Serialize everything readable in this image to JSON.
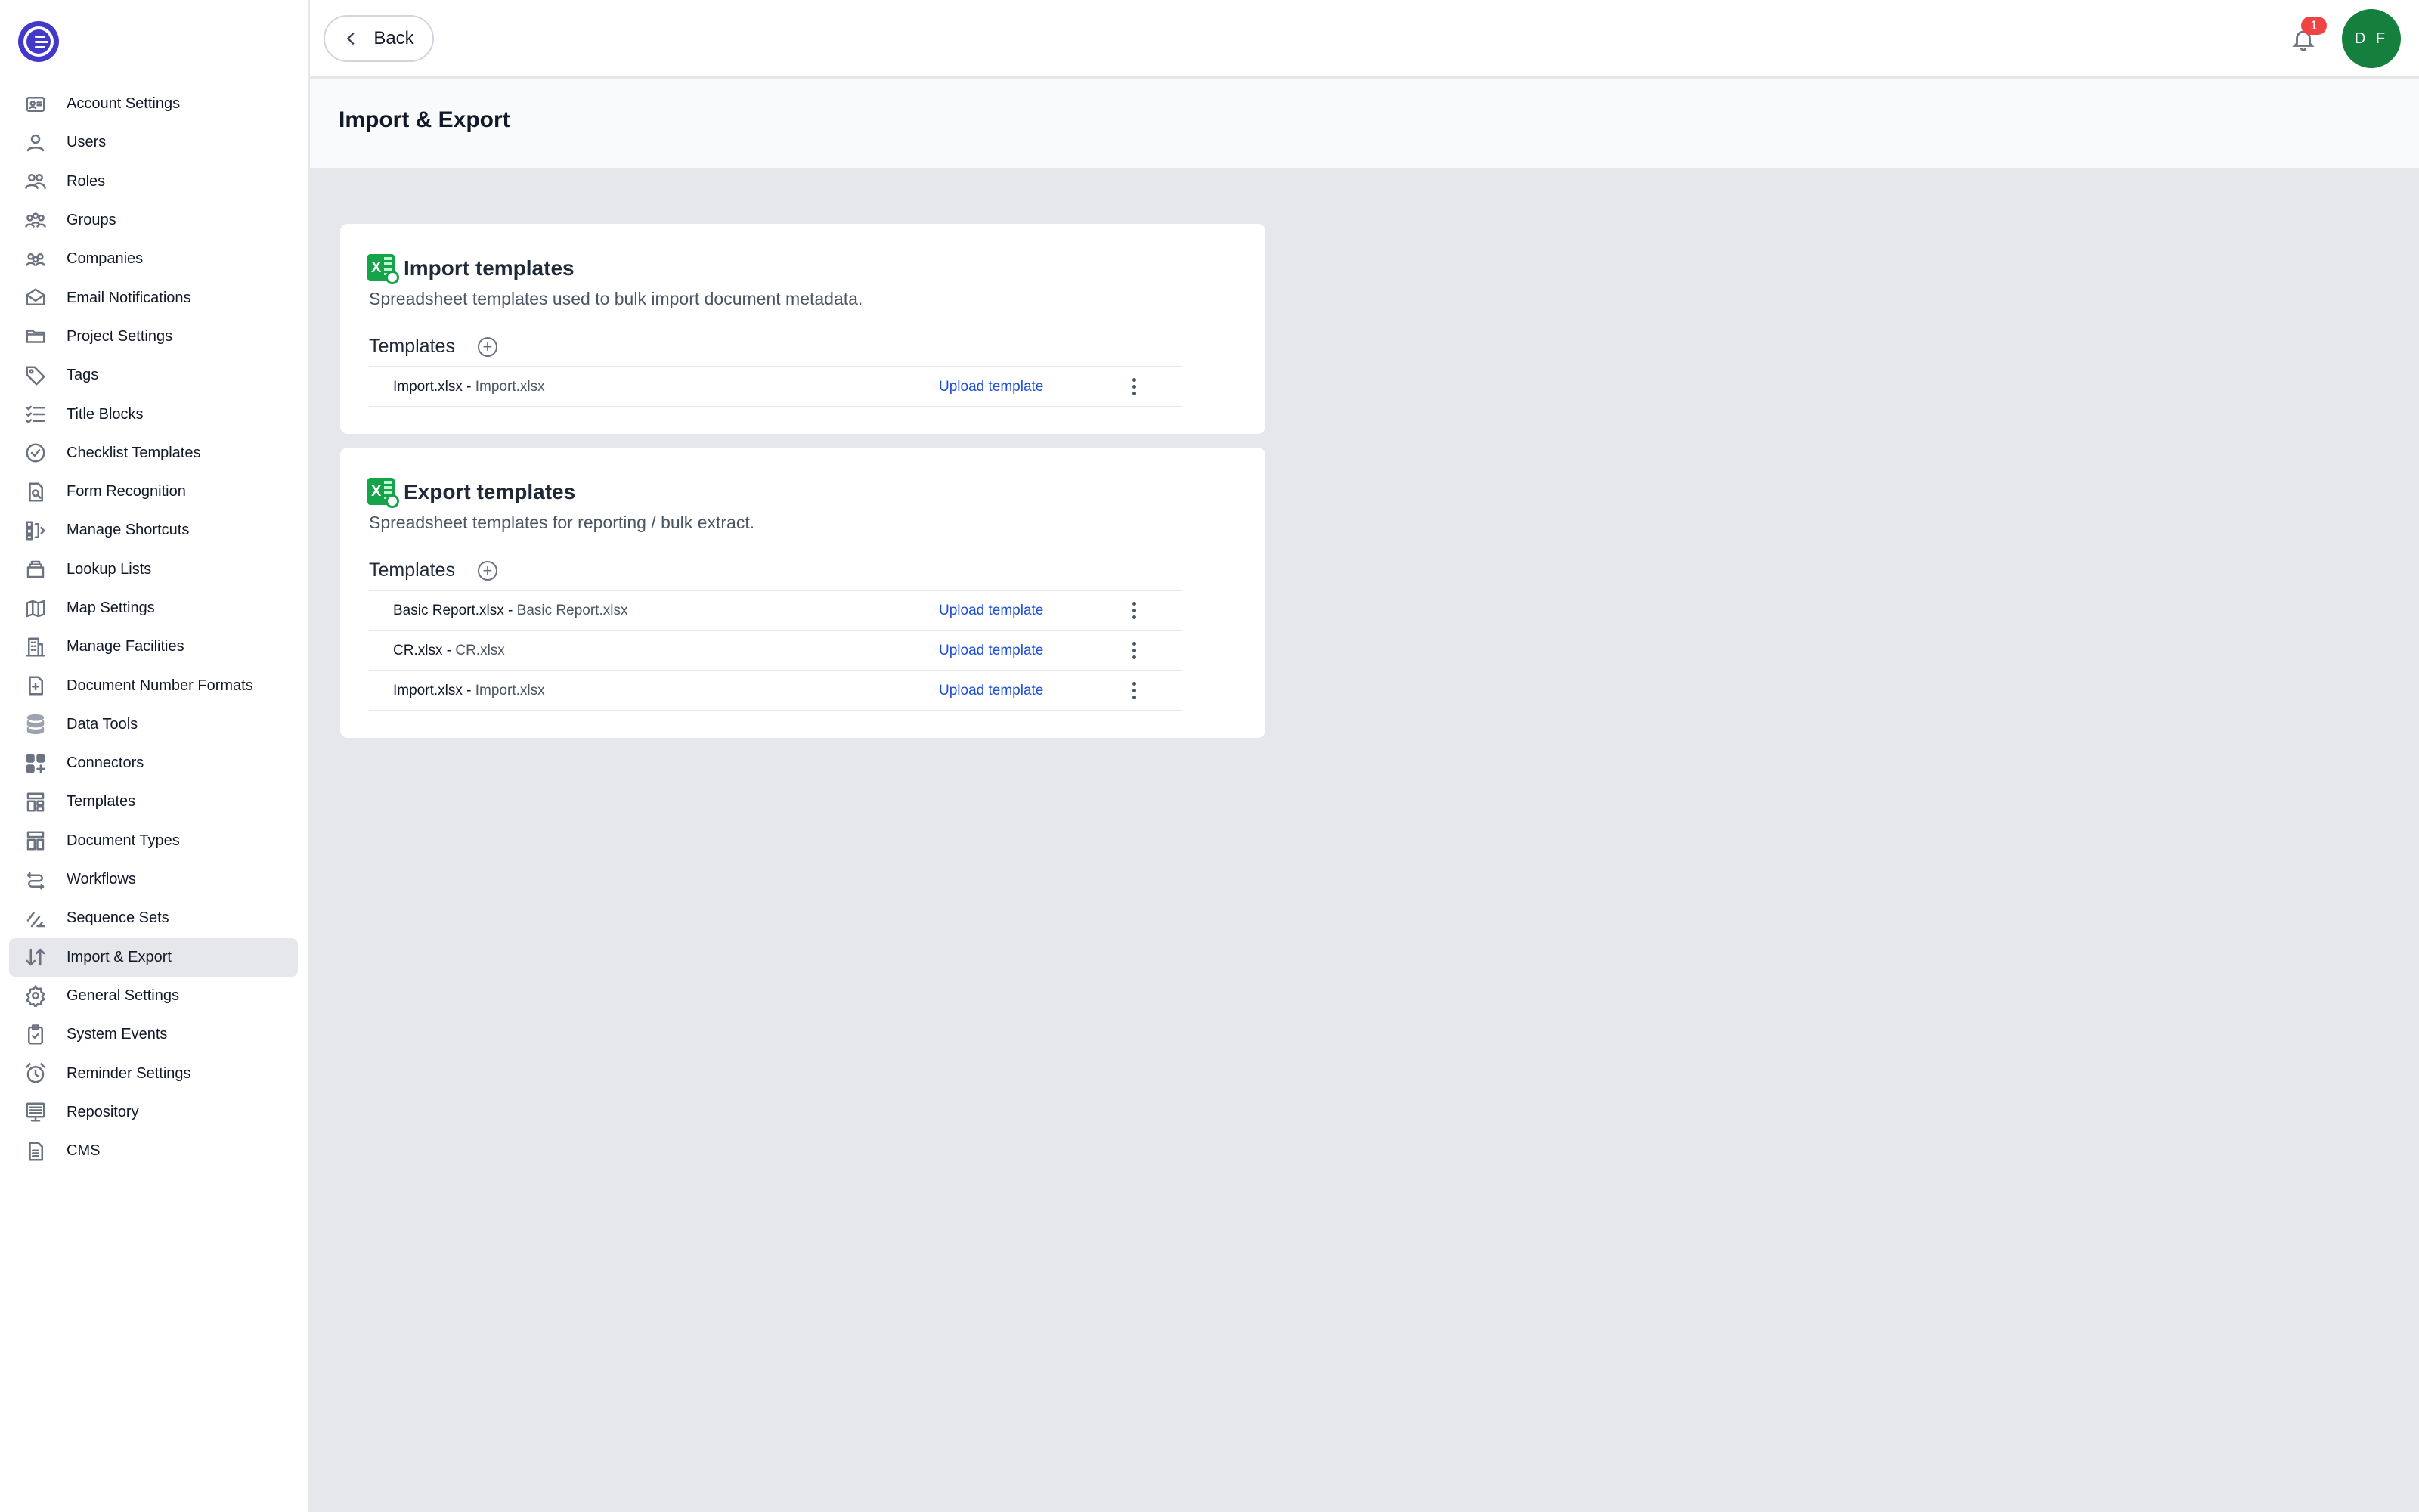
{
  "sidebar": {
    "items": [
      {
        "label": "Account Settings",
        "icon": "id-card-icon"
      },
      {
        "label": "Users",
        "icon": "user-icon"
      },
      {
        "label": "Roles",
        "icon": "roles-icon"
      },
      {
        "label": "Groups",
        "icon": "group-icon"
      },
      {
        "label": "Companies",
        "icon": "companies-icon"
      },
      {
        "label": "Email Notifications",
        "icon": "envelope-icon"
      },
      {
        "label": "Project Settings",
        "icon": "folder-icon"
      },
      {
        "label": "Tags",
        "icon": "tag-icon"
      },
      {
        "label": "Title Blocks",
        "icon": "checklist-lines-icon"
      },
      {
        "label": "Checklist Templates",
        "icon": "check-circle-icon"
      },
      {
        "label": "Form Recognition",
        "icon": "document-search-icon"
      },
      {
        "label": "Manage Shortcuts",
        "icon": "shortcuts-icon"
      },
      {
        "label": "Lookup Lists",
        "icon": "stack-icon"
      },
      {
        "label": "Map Settings",
        "icon": "map-icon"
      },
      {
        "label": "Manage Facilities",
        "icon": "building-icon"
      },
      {
        "label": "Document Number Formats",
        "icon": "document-plus-icon"
      },
      {
        "label": "Data Tools",
        "icon": "database-icon"
      },
      {
        "label": "Connectors",
        "icon": "grid-plus-icon"
      },
      {
        "label": "Templates",
        "icon": "layout-icon"
      },
      {
        "label": "Document Types",
        "icon": "layout-alt-icon"
      },
      {
        "label": "Workflows",
        "icon": "workflow-icon"
      },
      {
        "label": "Sequence Sets",
        "icon": "sequence-icon"
      },
      {
        "label": "Import & Export",
        "icon": "arrows-up-down-icon",
        "active": true
      },
      {
        "label": "General Settings",
        "icon": "gear-icon"
      },
      {
        "label": "System Events",
        "icon": "clipboard-check-icon"
      },
      {
        "label": "Reminder Settings",
        "icon": "alarm-clock-icon"
      },
      {
        "label": "Repository",
        "icon": "repository-icon"
      },
      {
        "label": "CMS",
        "icon": "document-icon"
      }
    ]
  },
  "topbar": {
    "back_label": "Back",
    "notification_count": "1",
    "avatar_initials": "D F"
  },
  "page": {
    "title": "Import & Export"
  },
  "import_card": {
    "title": "Import templates",
    "description": "Spreadsheet templates used to bulk import document metadata.",
    "templates_label": "Templates",
    "rows": [
      {
        "name": "Import.xlsx",
        "sep": " - ",
        "file": "Import.xlsx",
        "action": "Upload template"
      }
    ]
  },
  "export_card": {
    "title": "Export templates",
    "description": "Spreadsheet templates for reporting / bulk extract.",
    "templates_label": "Templates",
    "rows": [
      {
        "name": "Basic Report.xlsx",
        "sep": " - ",
        "file": "Basic Report.xlsx",
        "action": "Upload template"
      },
      {
        "name": "CR.xlsx",
        "sep": " - ",
        "file": "CR.xlsx",
        "action": "Upload template"
      },
      {
        "name": "Import.xlsx",
        "sep": " - ",
        "file": "Import.xlsx",
        "action": "Upload template"
      }
    ]
  },
  "colors": {
    "brand": "#4338ca",
    "link": "#1d4ed8",
    "avatar": "#15803d",
    "badge": "#ef4444",
    "excel": "#16a34a"
  }
}
